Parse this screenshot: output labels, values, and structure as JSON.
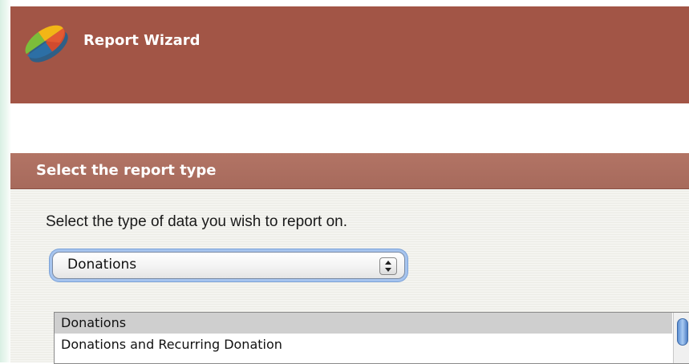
{
  "header": {
    "title": "Report Wizard",
    "logo_icon": "pie-chart-logo-icon",
    "background": "#a25546"
  },
  "section": {
    "title": "Select the report type",
    "header_color": "#aa6e5f",
    "instruction": "Select the type of data you wish to report on."
  },
  "report_type_select": {
    "selected": "Donations",
    "icon": "updown-arrows-icon"
  },
  "report_type_list": {
    "items": [
      {
        "label": "Donations",
        "selected": true
      },
      {
        "label": "Donations and Recurring Donation",
        "selected": false
      }
    ]
  }
}
